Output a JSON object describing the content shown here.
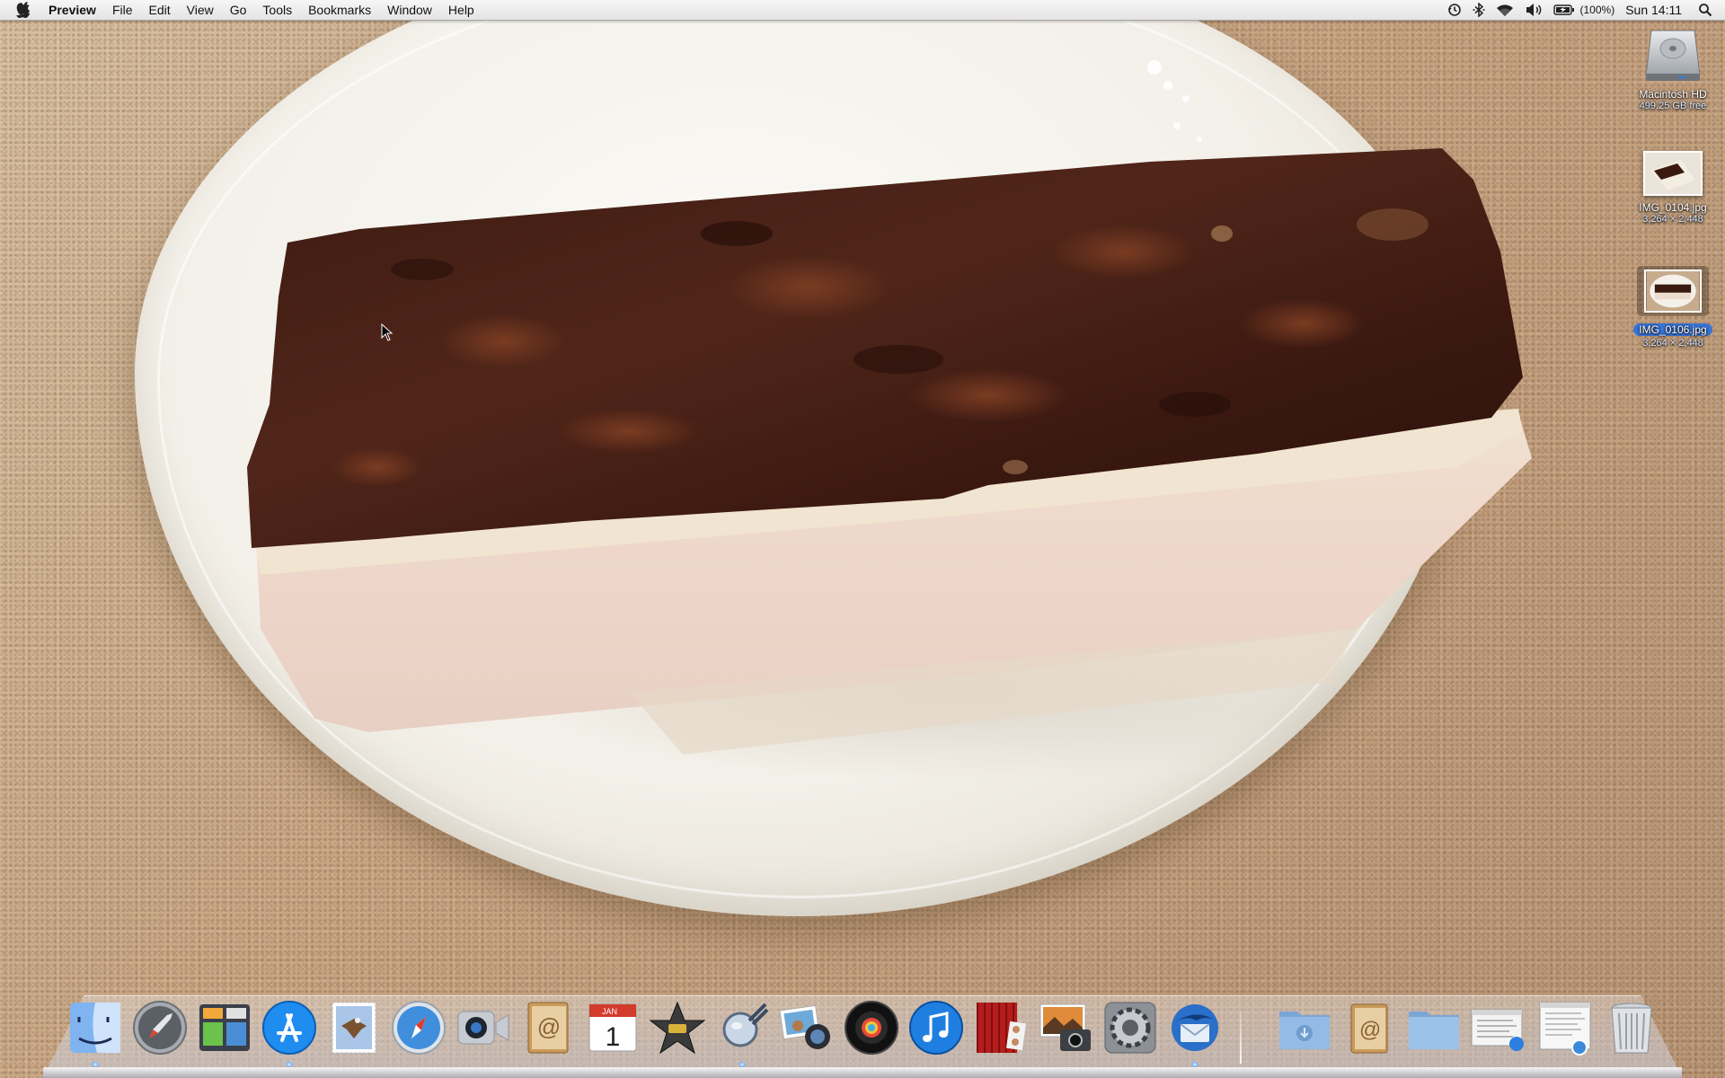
{
  "menubar": {
    "apple_icon": "apple-icon",
    "app_name": "Preview",
    "items": [
      "File",
      "Edit",
      "View",
      "Go",
      "Tools",
      "Bookmarks",
      "Window",
      "Help"
    ],
    "status": {
      "icons": [
        "time-machine-icon",
        "bluetooth-icon",
        "wifi-icon",
        "volume-icon",
        "battery-icon",
        "spotlight-icon"
      ],
      "battery_text": "(100%)",
      "clock": "Sun 14:11"
    }
  },
  "desktop": {
    "icons": [
      {
        "label": "Macintosh HD",
        "sub": "499.25 GB free",
        "icon": "hard-drive-icon"
      },
      {
        "label": "IMG_0104.jpg",
        "sub": "3,264 × 2,448",
        "icon": "image-thumbnail-icon"
      },
      {
        "label": "IMG_0106.jpg",
        "sub": "3,264 × 2,448",
        "icon": "image-thumbnail-icon"
      }
    ]
  },
  "dock": {
    "items": [
      "Finder",
      "Launchpad",
      "Dashboard",
      "App Store",
      "Mail",
      "Safari",
      "FaceTime",
      "Address Book",
      "iCal",
      "iMovie",
      "Preview",
      "iPhoto",
      "Aperture",
      "iTunes",
      "Photo Booth",
      "Image Capture",
      "System Preferences",
      "Thunderbird",
      "Downloads",
      "Address Book",
      "Documents",
      "Recent Document",
      "Document Stack",
      "Trash"
    ],
    "ical_month": "JAN",
    "ical_day": "1"
  }
}
